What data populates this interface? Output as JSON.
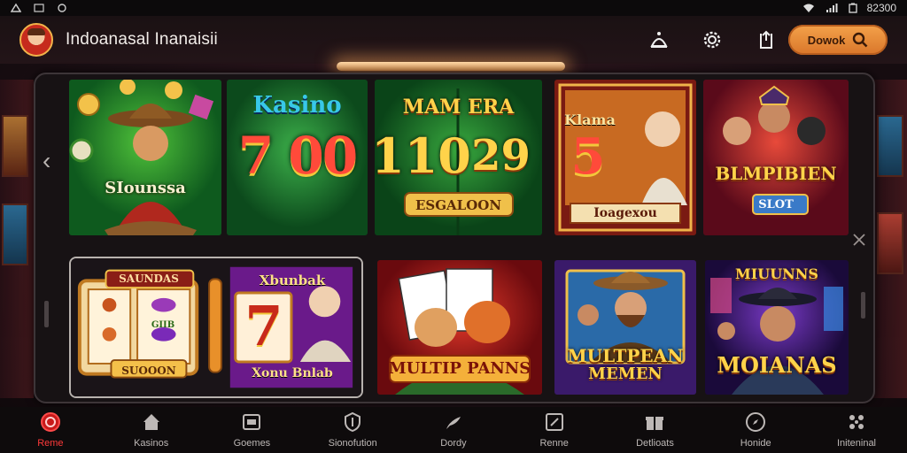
{
  "status": {
    "time": "82300"
  },
  "header": {
    "title": "Indoanasal Inanaisii",
    "search_label": "Dowok"
  },
  "tiles": {
    "t1": {
      "label": "SIounssa"
    },
    "t2": {
      "title": "Kasino",
      "number": "7 00"
    },
    "t3": {
      "title": "MAM ERA",
      "left_number": "110",
      "right_number": "29",
      "banner": "ESGALOON"
    },
    "t4": {
      "title": "Klama",
      "number": "5",
      "banner": "Ioagexou"
    },
    "t5": {
      "title": "BLMPIBIEN",
      "badge": "SLOT"
    },
    "t6": {
      "title": "SAUNDAS",
      "badge": "SUOOON",
      "symbol_text": "GIIB",
      "right_title": "Xbunbak",
      "right_number": "7",
      "right_banner": "Xonu Bnlab"
    },
    "t7": {
      "title": "MULTIP PANNS"
    },
    "t8": {
      "title": "MULTPEAN",
      "subtitle": "MEMEN"
    },
    "t9": {
      "top": "MIUUNNS",
      "title": "MOIANAS"
    }
  },
  "nav": [
    {
      "label": "Reme",
      "icon": "casino-chip-icon",
      "active": true
    },
    {
      "label": "Kasinos",
      "icon": "home-icon",
      "active": false
    },
    {
      "label": "Goemes",
      "icon": "games-icon",
      "active": false
    },
    {
      "label": "Sionofution",
      "icon": "shield-icon",
      "active": false
    },
    {
      "label": "Dordy",
      "icon": "flag-icon",
      "active": false
    },
    {
      "label": "Renne",
      "icon": "edit-icon",
      "active": false
    },
    {
      "label": "Detlioats",
      "icon": "gift-icon",
      "active": false
    },
    {
      "label": "Honide",
      "icon": "compass-icon",
      "active": false
    },
    {
      "label": "Initeninal",
      "icon": "grid-dots-icon",
      "active": false
    }
  ],
  "colors": {
    "accent": "#e8872f",
    "active_nav": "#ff3a3a",
    "gold": "#ffd34a"
  }
}
